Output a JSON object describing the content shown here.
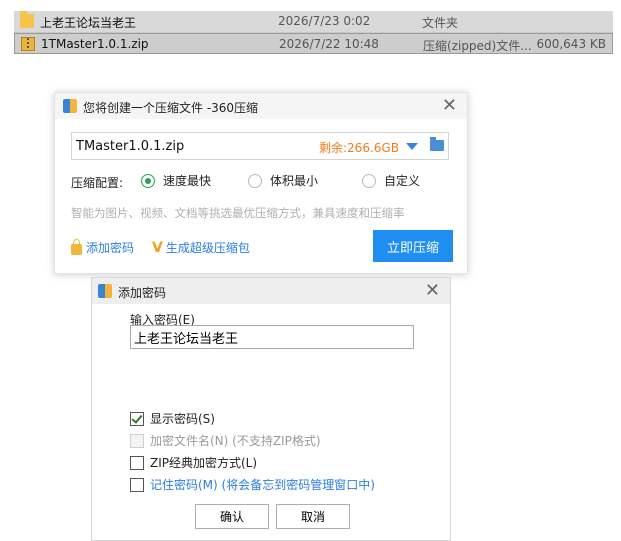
{
  "explorer": {
    "rows": [
      {
        "name": "上老王论坛当老王",
        "date": "2026/7/23 0:02",
        "type": "文件夹",
        "size": "",
        "icon": "folder-icon"
      },
      {
        "name": "1TMaster1.0.1.zip",
        "date": "2026/7/22 10:48",
        "type": "压缩(zipped)文件...",
        "size": "600,643 KB",
        "icon": "zip-file-icon"
      }
    ]
  },
  "compress_dialog": {
    "title": "您将创建一个压缩文件 -360压缩",
    "close": "✕",
    "filename": "TMaster1.0.1.zip",
    "free_space": "剩余:266.6GB",
    "config_label": "压缩配置:",
    "options": [
      {
        "label": "速度最快",
        "checked": true
      },
      {
        "label": "体积最小",
        "checked": false
      },
      {
        "label": "自定义",
        "checked": false
      }
    ],
    "hint": "智能为图片、视频、文档等挑选最优压缩方式，兼具速度和压缩率",
    "add_password": "添加密码",
    "super_package": "生成超级压缩包",
    "compress_now": "立即压缩"
  },
  "password_dialog": {
    "title": "添加密码",
    "close": "✕",
    "input_label": "输入密码(E)",
    "password_value": "上老王论坛当老王",
    "checkboxes": [
      {
        "label": "显示密码(S)",
        "checked": true,
        "disabled": false
      },
      {
        "label": "加密文件名(N) (不支持ZIP格式)",
        "checked": false,
        "disabled": true
      },
      {
        "label": "ZIP经典加密方式(L)",
        "checked": false,
        "disabled": false
      },
      {
        "label": "记住密码(M) (将会备忘到密码管理窗口中)",
        "checked": false,
        "disabled": false
      }
    ],
    "ok": "确认",
    "cancel": "取消"
  },
  "colors": {
    "accent": "#1e8ff0",
    "free_space": "#f07b1a",
    "radio_checked": "#2a9e55",
    "link": "#2a7de1"
  }
}
